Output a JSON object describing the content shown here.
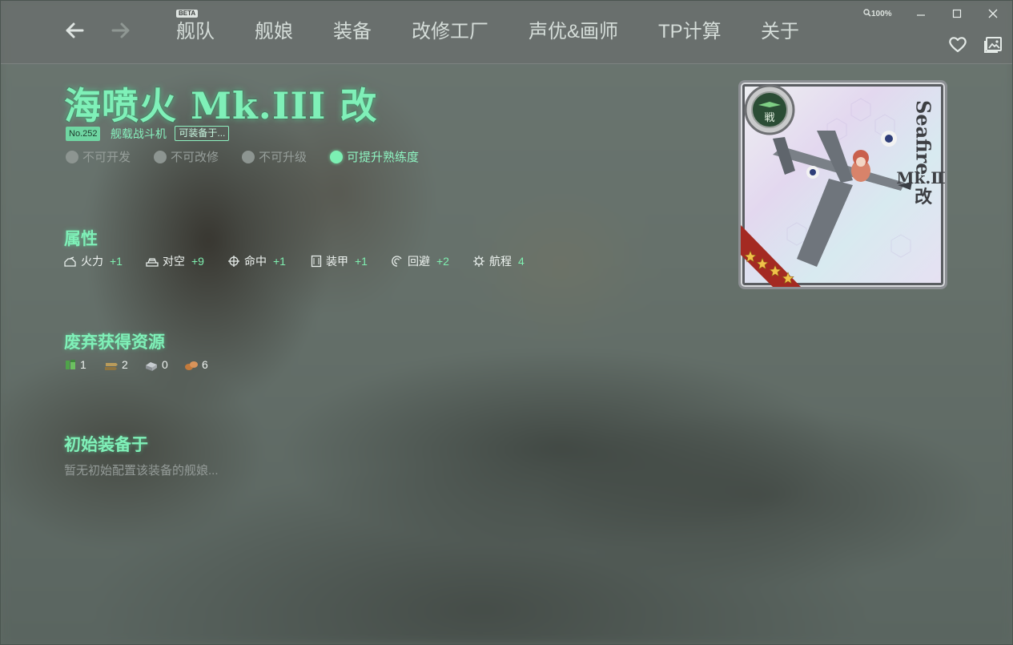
{
  "nav": {
    "back_icon": "arrow-left-icon",
    "forward_icon": "arrow-right-icon",
    "beta": "BETA",
    "items": [
      {
        "label": "舰队"
      },
      {
        "label": "舰娘"
      },
      {
        "label": "装备"
      },
      {
        "label": "改修工厂"
      },
      {
        "label": "声优&画师"
      },
      {
        "label": "TP计算"
      },
      {
        "label": "关于"
      }
    ]
  },
  "window": {
    "zoom": "100%",
    "minimize_icon": "minimize-icon",
    "maximize_icon": "maximize-icon",
    "close_icon": "close-icon",
    "favorite_icon": "heart-icon",
    "gallery_icon": "gallery-icon"
  },
  "equipment": {
    "name": "海喷火 Mk.III 改",
    "number": "No.252",
    "type": "舰载战斗机",
    "equippable_button": "可装备于...",
    "status": [
      {
        "label": "不可开发",
        "enabled": false
      },
      {
        "label": "不可改修",
        "enabled": false
      },
      {
        "label": "不可升级",
        "enabled": false
      },
      {
        "label": "可提升熟练度",
        "enabled": true
      }
    ]
  },
  "stats": {
    "heading": "属性",
    "items": [
      {
        "icon": "firepower-icon",
        "label": "火力",
        "value": "+1"
      },
      {
        "icon": "anti-air-icon",
        "label": "对空",
        "value": "+9"
      },
      {
        "icon": "accuracy-icon",
        "label": "命中",
        "value": "+1"
      },
      {
        "icon": "armor-icon",
        "label": "装甲",
        "value": "+1"
      },
      {
        "icon": "evasion-icon",
        "label": "回避",
        "value": "+2"
      },
      {
        "icon": "range-icon",
        "label": "航程",
        "value": "4"
      }
    ]
  },
  "scrap": {
    "heading": "废弃获得资源",
    "items": [
      {
        "icon": "fuel-icon",
        "value": "1"
      },
      {
        "icon": "ammo-icon",
        "value": "2"
      },
      {
        "icon": "steel-icon",
        "value": "0"
      },
      {
        "icon": "bauxite-icon",
        "value": "6"
      }
    ]
  },
  "initial": {
    "heading": "初始装备于",
    "empty_note": "暂无初始配置该装备的舰娘..."
  },
  "card": {
    "name_vertical": "Seafire",
    "mark": "Mk.Ⅲ",
    "kai": "改",
    "type_badge": "戦",
    "rarity_stars": 4
  }
}
